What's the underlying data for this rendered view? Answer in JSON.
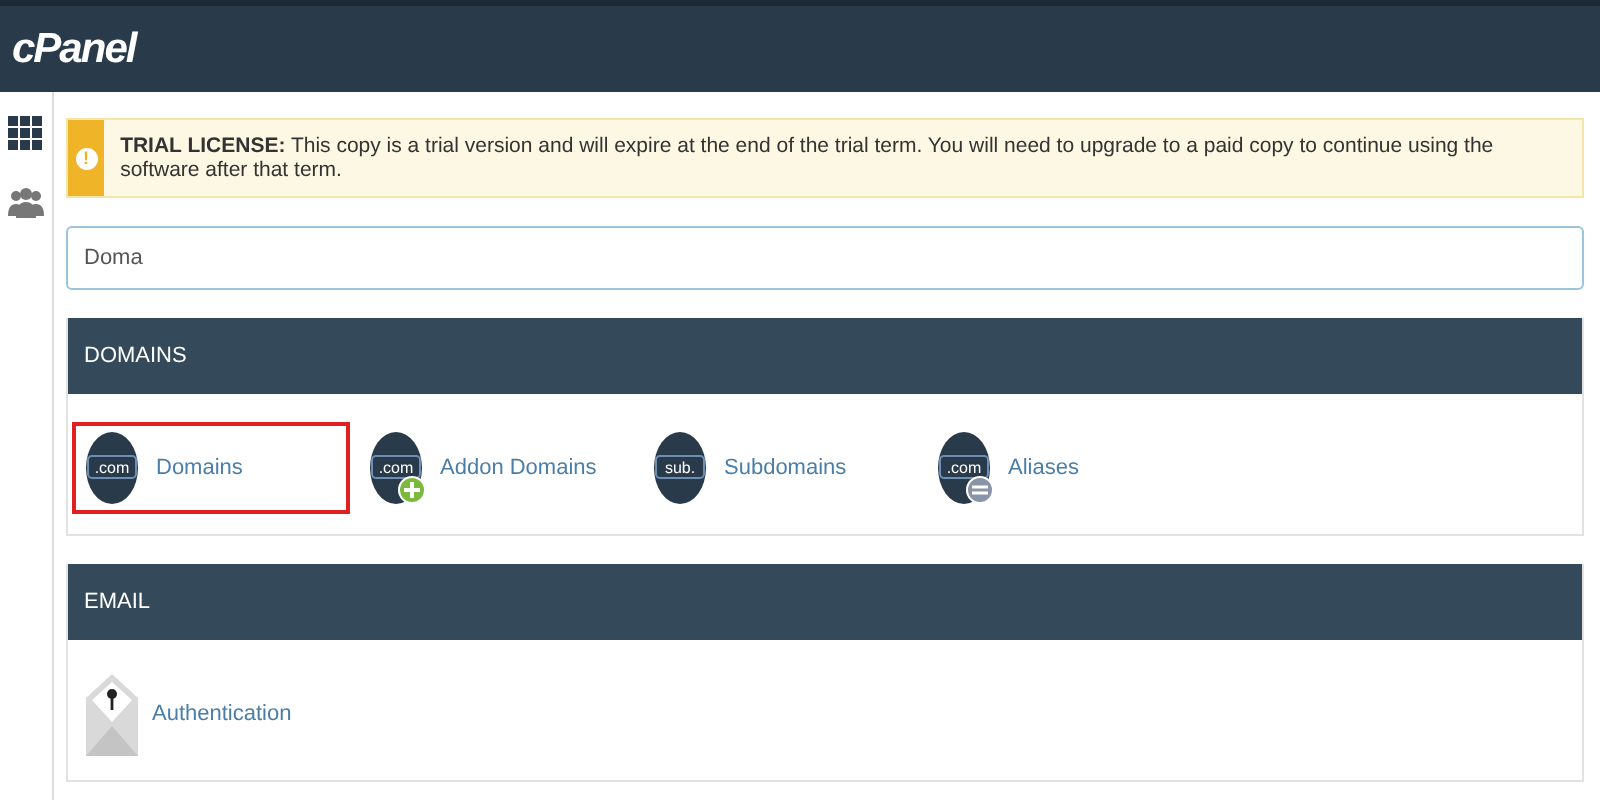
{
  "header": {
    "logo": "cPanel"
  },
  "sidebar": {
    "items": [
      {
        "kind": "grid",
        "selected": true
      },
      {
        "kind": "users",
        "selected": false
      }
    ]
  },
  "notice": {
    "badge": "!",
    "text": "**TRIAL LICENSE:** This copy is a trial version and will expire at the end of the trial term. You will need to upgrade to a paid copy to continue using the software after that term."
  },
  "search": {
    "value": "Doma"
  },
  "panels": [
    {
      "title": "DOMAINS",
      "items": [
        {
          "label": "Domains",
          "kind": "circle",
          "icon_text": ".com",
          "highlighted": true
        },
        {
          "label": "Addon Domains",
          "kind": "circleadd",
          "icon_text": ".com",
          "highlighted": false
        },
        {
          "label": "Subdomains",
          "kind": "circle",
          "icon_text": "sub.",
          "highlighted": false
        },
        {
          "label": "Aliases",
          "kind": "circleremove",
          "icon_text": ".com",
          "highlighted": false
        }
      ]
    },
    {
      "title": "EMAIL",
      "items": [
        {
          "label": "Authentication",
          "kind": "envelope",
          "highlighted": false
        }
      ]
    }
  ]
}
